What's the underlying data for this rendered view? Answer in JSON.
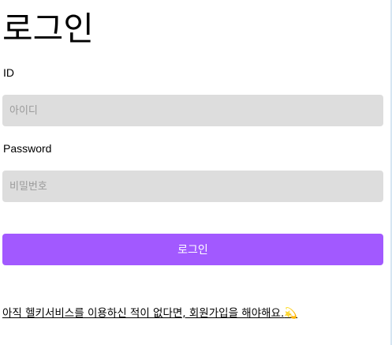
{
  "page": {
    "title": "로그인"
  },
  "form": {
    "id_label": "ID",
    "id_placeholder": "아이디",
    "password_label": "Password",
    "password_placeholder": "비밀번호",
    "submit_label": "로그인"
  },
  "signup": {
    "text": "아직 헬키서비스를 이용하신 적이 없다면, 회원가입을 해야해요.",
    "emoji": "💫"
  },
  "colors": {
    "accent": "#a259ff",
    "input_background": "#dddddd",
    "placeholder": "#9a9a9a"
  }
}
